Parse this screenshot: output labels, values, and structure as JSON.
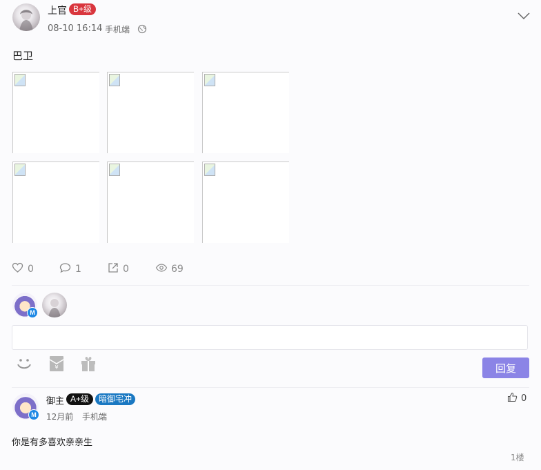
{
  "post": {
    "author": "上官",
    "level_badge": "B+级",
    "date": "08-10 16:14",
    "device": "手机端",
    "content": "巴卫",
    "images": 6,
    "stats": {
      "likes": "0",
      "comments": "1",
      "shares": "0",
      "views": "69"
    }
  },
  "reply_box": {
    "placeholder": "",
    "submit_label": "回复"
  },
  "comments": [
    {
      "author": "御主",
      "level_badge": "A+级",
      "group_badge": "暗御宅冲",
      "time": "12月前",
      "device": "手机端",
      "content": "你是有多喜欢亲亲生",
      "likes": "0",
      "floor": "1楼"
    }
  ],
  "colors": {
    "b_badge": "#d9363e",
    "a_badge": "#111111",
    "group_badge": "#1a78c2",
    "reply_button": "#8b84e6"
  },
  "icons": [
    "chevron-down-icon",
    "globe-icon",
    "heart-icon",
    "comment-icon",
    "share-icon",
    "eye-icon",
    "smile-icon",
    "red-envelope-icon",
    "gift-icon",
    "thumbs-up-icon"
  ]
}
